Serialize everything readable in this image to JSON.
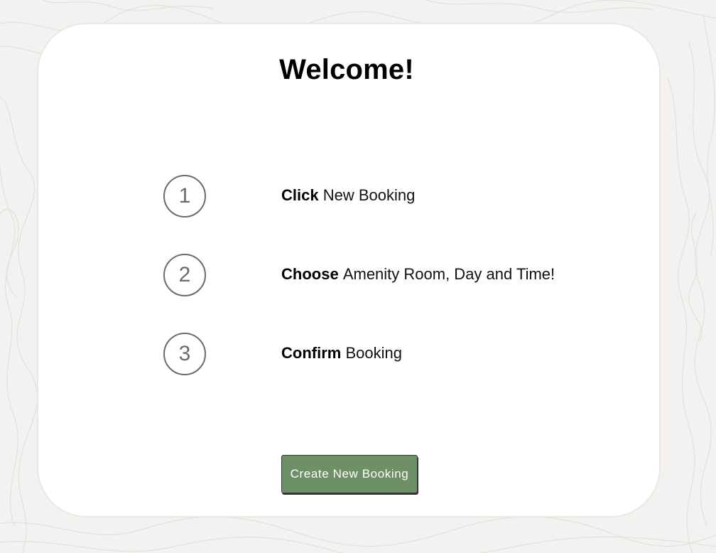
{
  "page": {
    "title": "Welcome!"
  },
  "steps": [
    {
      "number": "1",
      "action": "Click",
      "detail": "New Booking"
    },
    {
      "number": "2",
      "action": "Choose",
      "detail": "Amenity Room, Day and Time!"
    },
    {
      "number": "3",
      "action": "Confirm",
      "detail": "Booking"
    }
  ],
  "actions": {
    "create_label": "Create New Booking"
  },
  "colors": {
    "background": "#f3f2f0",
    "card": "#ffffff",
    "button": "#6e9066",
    "step_circle": "#6b6b6b"
  }
}
